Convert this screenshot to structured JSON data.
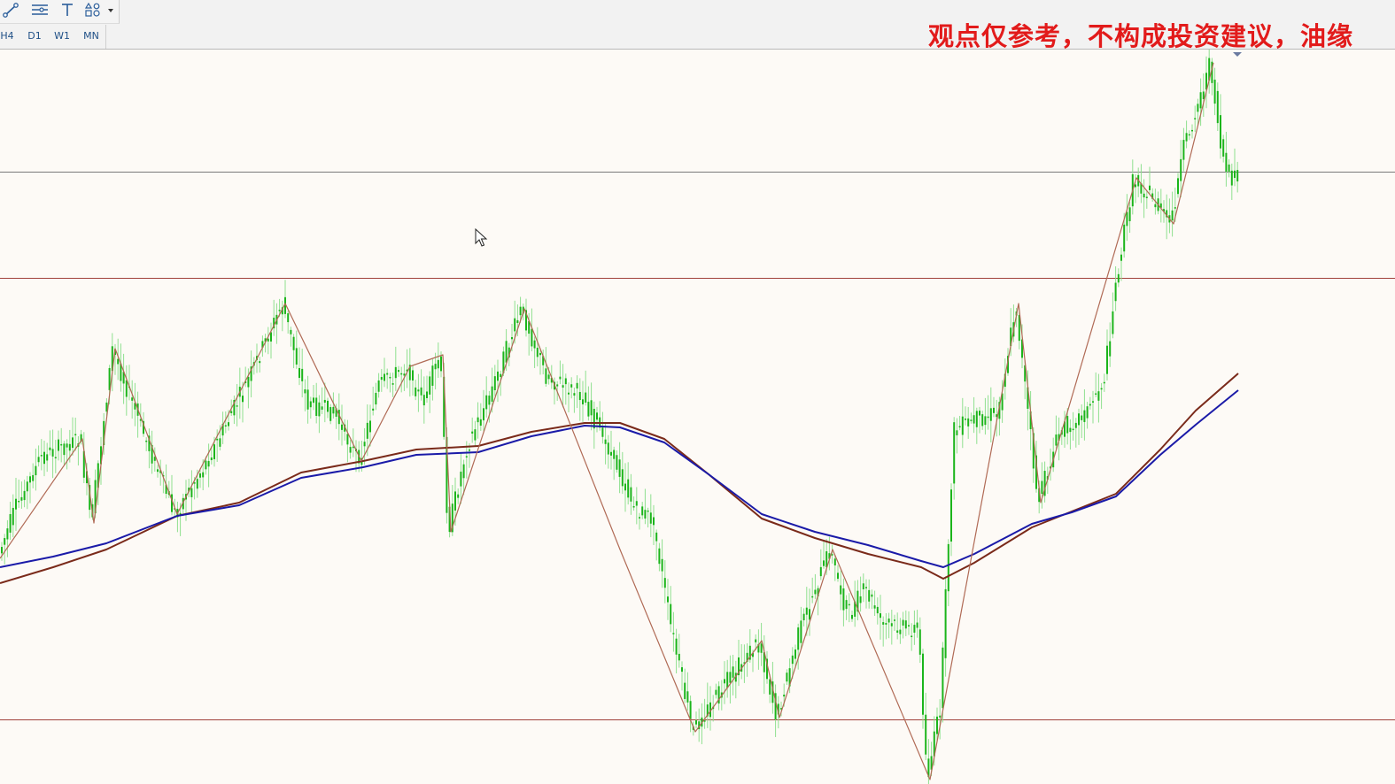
{
  "toolbar": {
    "tools": [
      {
        "name": "trendline-tool",
        "icon": "trendline-icon"
      },
      {
        "name": "channel-tool",
        "icon": "channel-lines-icon"
      },
      {
        "name": "text-tool",
        "icon": "text-t-icon"
      },
      {
        "name": "shapes-tool",
        "icon": "shapes-icon"
      }
    ],
    "timeframes": [
      "H4",
      "D1",
      "W1",
      "MN"
    ]
  },
  "disclaimer": "观点仅参考，不构成投资建议，油缘",
  "colors": {
    "background": "#fdfaf6",
    "candle": "#1bb51b",
    "candle_light": "#8fe08f",
    "zigzag": "#b06a55",
    "ma_fast": "#1a1aa8",
    "ma_slow": "#7a2a1a",
    "hline_gray": "#7a7a7a",
    "hline_red": "#a0403a",
    "disclaimer": "#e21b1b"
  },
  "chart_data": {
    "type": "candlestick",
    "y_range": [
      0,
      830
    ],
    "horizontal_levels": [
      {
        "name": "level-upper",
        "value": 138,
        "color": "gray"
      },
      {
        "name": "level-mid",
        "value": 258,
        "color": "red"
      },
      {
        "name": "level-low",
        "value": 757,
        "color": "red"
      }
    ],
    "zigzag": [
      [
        0,
        575
      ],
      [
        93,
        440
      ],
      [
        106,
        535
      ],
      [
        130,
        338
      ],
      [
        200,
        525
      ],
      [
        322,
        287
      ],
      [
        408,
        465
      ],
      [
        463,
        358
      ],
      [
        500,
        345
      ],
      [
        509,
        545
      ],
      [
        592,
        293
      ],
      [
        700,
        565
      ],
      [
        785,
        771
      ],
      [
        860,
        668
      ],
      [
        880,
        755
      ],
      [
        940,
        565
      ],
      [
        1050,
        825
      ],
      [
        1150,
        287
      ],
      [
        1175,
        512
      ],
      [
        1283,
        145
      ],
      [
        1325,
        197
      ],
      [
        1370,
        15
      ]
    ],
    "ma_fast": [
      [
        0,
        585
      ],
      [
        60,
        573
      ],
      [
        120,
        558
      ],
      [
        200,
        527
      ],
      [
        270,
        515
      ],
      [
        340,
        484
      ],
      [
        410,
        472
      ],
      [
        470,
        458
      ],
      [
        540,
        455
      ],
      [
        600,
        437
      ],
      [
        660,
        425
      ],
      [
        700,
        427
      ],
      [
        750,
        444
      ],
      [
        800,
        480
      ],
      [
        860,
        525
      ],
      [
        920,
        545
      ],
      [
        980,
        560
      ],
      [
        1040,
        578
      ],
      [
        1065,
        585
      ],
      [
        1100,
        570
      ],
      [
        1165,
        536
      ],
      [
        1210,
        523
      ],
      [
        1260,
        505
      ],
      [
        1310,
        458
      ],
      [
        1350,
        424
      ],
      [
        1398,
        385
      ]
    ],
    "ma_slow": [
      [
        0,
        603
      ],
      [
        60,
        585
      ],
      [
        120,
        565
      ],
      [
        200,
        527
      ],
      [
        270,
        512
      ],
      [
        340,
        478
      ],
      [
        410,
        465
      ],
      [
        470,
        452
      ],
      [
        540,
        448
      ],
      [
        600,
        432
      ],
      [
        660,
        422
      ],
      [
        700,
        422
      ],
      [
        750,
        440
      ],
      [
        800,
        480
      ],
      [
        860,
        530
      ],
      [
        920,
        552
      ],
      [
        980,
        570
      ],
      [
        1040,
        585
      ],
      [
        1065,
        598
      ],
      [
        1100,
        580
      ],
      [
        1165,
        540
      ],
      [
        1210,
        522
      ],
      [
        1260,
        502
      ],
      [
        1310,
        452
      ],
      [
        1350,
        408
      ],
      [
        1398,
        366
      ]
    ],
    "price_path": [
      [
        0,
        575
      ],
      [
        20,
        520
      ],
      [
        50,
        460
      ],
      [
        93,
        440
      ],
      [
        106,
        535
      ],
      [
        130,
        338
      ],
      [
        160,
        420
      ],
      [
        200,
        525
      ],
      [
        240,
        460
      ],
      [
        285,
        370
      ],
      [
        322,
        287
      ],
      [
        350,
        400
      ],
      [
        380,
        410
      ],
      [
        408,
        465
      ],
      [
        430,
        380
      ],
      [
        463,
        358
      ],
      [
        480,
        400
      ],
      [
        500,
        345
      ],
      [
        509,
        545
      ],
      [
        530,
        450
      ],
      [
        560,
        380
      ],
      [
        592,
        293
      ],
      [
        620,
        370
      ],
      [
        660,
        390
      ],
      [
        700,
        470
      ],
      [
        720,
        520
      ],
      [
        740,
        530
      ],
      [
        760,
        650
      ],
      [
        785,
        771
      ],
      [
        820,
        720
      ],
      [
        860,
        668
      ],
      [
        880,
        755
      ],
      [
        905,
        660
      ],
      [
        940,
        565
      ],
      [
        960,
        640
      ],
      [
        980,
        610
      ],
      [
        1000,
        650
      ],
      [
        1040,
        655
      ],
      [
        1050,
        825
      ],
      [
        1065,
        740
      ],
      [
        1080,
        430
      ],
      [
        1100,
        420
      ],
      [
        1130,
        410
      ],
      [
        1150,
        287
      ],
      [
        1175,
        512
      ],
      [
        1200,
        430
      ],
      [
        1230,
        410
      ],
      [
        1250,
        370
      ],
      [
        1265,
        250
      ],
      [
        1283,
        145
      ],
      [
        1305,
        170
      ],
      [
        1325,
        197
      ],
      [
        1340,
        110
      ],
      [
        1370,
        15
      ],
      [
        1380,
        100
      ],
      [
        1390,
        150
      ],
      [
        1398,
        140
      ]
    ]
  }
}
